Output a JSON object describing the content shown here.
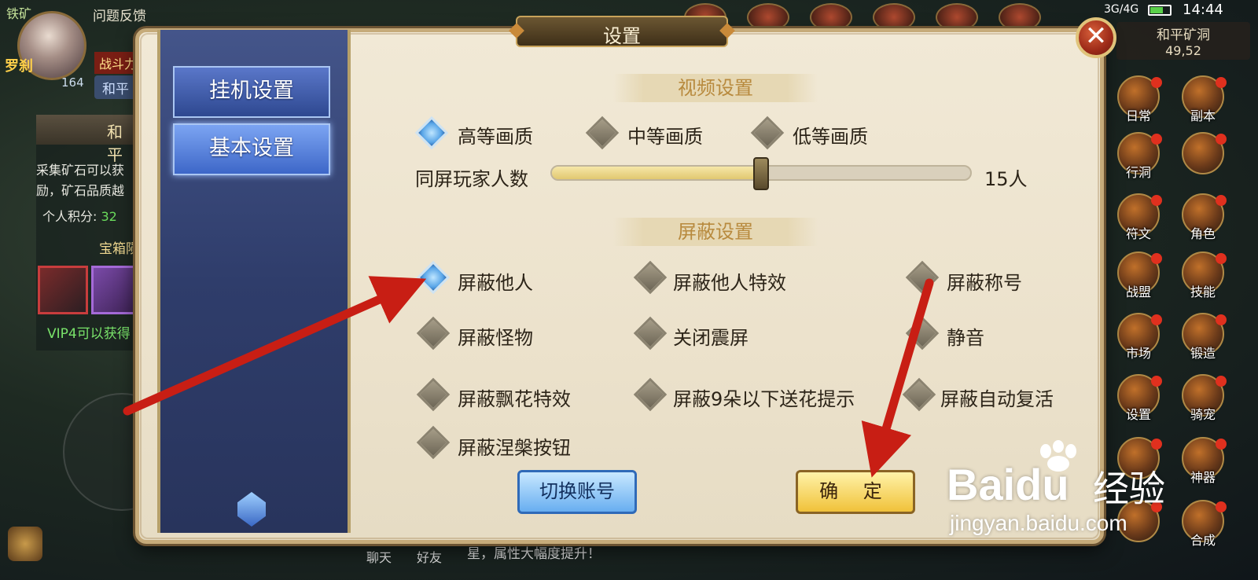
{
  "hud": {
    "resource_label": "铁矿",
    "feedback": "问题反馈",
    "player_level": "164",
    "player_name_fragment": "罗刹",
    "battle_power_label": "战斗力",
    "peace_mode": "和平",
    "mine_title": "和平",
    "mine_desc": "采集矿石可以获励，矿石品质越",
    "personal_score_label": "个人积分:",
    "personal_score_value": "32",
    "chest_label": "宝箱陨",
    "vip_text": "VIP4可以获得",
    "chat_text": "星，属性大幅度提升！",
    "chat_button": "聊天",
    "friends_button": "好友"
  },
  "status_bar": {
    "network": "3G/4G",
    "time": "14:44",
    "map_name": "和平矿洞",
    "coords": "49,52"
  },
  "side_menu": [
    {
      "label": "日常"
    },
    {
      "label": "副本"
    },
    {
      "label": "行洞"
    },
    {
      "label": ""
    },
    {
      "label": "符文"
    },
    {
      "label": "角色"
    },
    {
      "label": "战盟"
    },
    {
      "label": "技能"
    },
    {
      "label": "市场"
    },
    {
      "label": "锻造"
    },
    {
      "label": "设置"
    },
    {
      "label": "骑宠"
    },
    {
      "label": ""
    },
    {
      "label": "神器"
    },
    {
      "label": ""
    },
    {
      "label": "合成"
    }
  ],
  "dialog": {
    "title": "设置",
    "close_icon": "close-icon",
    "tabs": [
      {
        "label": "挂机设置",
        "active": false
      },
      {
        "label": "基本设置",
        "active": true
      }
    ],
    "video_section": {
      "header": "视频设置",
      "quality_options": [
        {
          "label": "高等画质",
          "selected": true
        },
        {
          "label": "中等画质",
          "selected": false
        },
        {
          "label": "低等画质",
          "selected": false
        }
      ],
      "player_count_label": "同屏玩家人数",
      "player_count_value": "15人",
      "player_count_level": 0.5
    },
    "block_section": {
      "header": "屏蔽设置",
      "options": [
        {
          "label": "屏蔽他人",
          "checked": true
        },
        {
          "label": "屏蔽他人特效",
          "checked": false
        },
        {
          "label": "屏蔽称号",
          "checked": false
        },
        {
          "label": "屏蔽怪物",
          "checked": false
        },
        {
          "label": "关闭震屏",
          "checked": false
        },
        {
          "label": "静音",
          "checked": false
        },
        {
          "label": "屏蔽飘花特效",
          "checked": false
        },
        {
          "label": "屏蔽9朵以下送花提示",
          "checked": false
        },
        {
          "label": "屏蔽自动复活",
          "checked": false
        },
        {
          "label": "屏蔽涅槃按钮",
          "checked": false
        }
      ]
    },
    "buttons": {
      "switch_account": "切换账号",
      "confirm": "确 定"
    }
  },
  "watermark": {
    "logo_text_a": "Bai",
    "logo_text_b": "du",
    "cn": "经验",
    "url": "jingyan.baidu.com"
  },
  "colors": {
    "annotation_arrow": "#c81e14",
    "selected_diamond": "#5aa6e8",
    "section_header_text": "#b88a3e"
  }
}
